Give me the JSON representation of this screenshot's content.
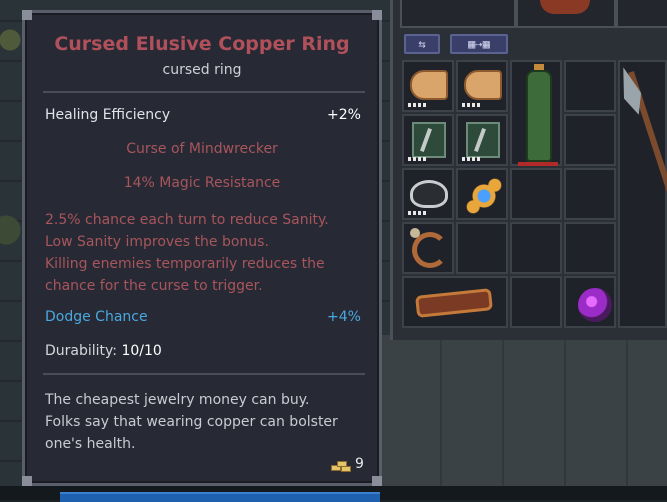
{
  "tooltip": {
    "title": "Cursed Elusive Copper Ring",
    "subtitle": "cursed ring",
    "healing": {
      "label": "Healing Efficiency",
      "value": "+2%"
    },
    "curse_name": "Curse of Mindwrecker",
    "curse_bonus": "14% Magic Resistance",
    "curse_desc": [
      "2.5% chance each turn to reduce Sanity.",
      "Low Sanity improves the bonus.",
      "Killing enemies temporarily reduces the",
      "chance for the curse to trigger."
    ],
    "dodge": {
      "label": "Dodge Chance",
      "value": "+4%"
    },
    "durability": {
      "label": "Durability:",
      "value": "10/10"
    },
    "lore": [
      "The cheapest jewelry money can buy.",
      "Folks say that wearing copper can bolster",
      "one's health."
    ],
    "price": "9"
  },
  "inventory": {
    "sort_icon": "sort-icon",
    "transfer_icon": "transfer-icon",
    "items": [
      {
        "name": "scroll-icon"
      },
      {
        "name": "scroll-icon"
      },
      {
        "name": "bottle-icon"
      },
      {
        "name": "lockpick-icon"
      },
      {
        "name": "lockpick-icon"
      },
      {
        "name": "pot-icon"
      },
      {
        "name": "amulet-icon"
      },
      {
        "name": "shackle-icon"
      },
      {
        "name": "stick-icon"
      },
      {
        "name": "potion-icon"
      },
      {
        "name": "spear-icon"
      }
    ]
  },
  "colors": {
    "curse_text": "#a8555c",
    "title": "#b0505a",
    "dodge": "#4aa8e0",
    "panel_bg": "#272a35"
  }
}
